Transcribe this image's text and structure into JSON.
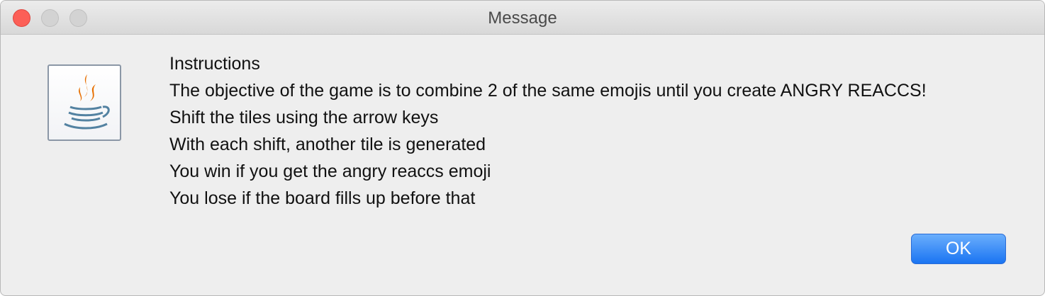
{
  "window": {
    "title": "Message"
  },
  "dialog": {
    "icon": "java-coffee-cup-icon",
    "lines": [
      "Instructions",
      "The objective of the game is to combine 2 of the same emojis until you create ANGRY REACCS!",
      "Shift the tiles using the arrow keys",
      "With each shift, another tile is generated",
      "You win if you get the angry reaccs emoji",
      "You lose if the board fills up before that"
    ]
  },
  "buttons": {
    "ok_label": "OK"
  },
  "colors": {
    "accent": "#1a74f2",
    "close_light": "#fc5f57",
    "java_orange": "#e76f00",
    "java_blue": "#5382a1"
  }
}
